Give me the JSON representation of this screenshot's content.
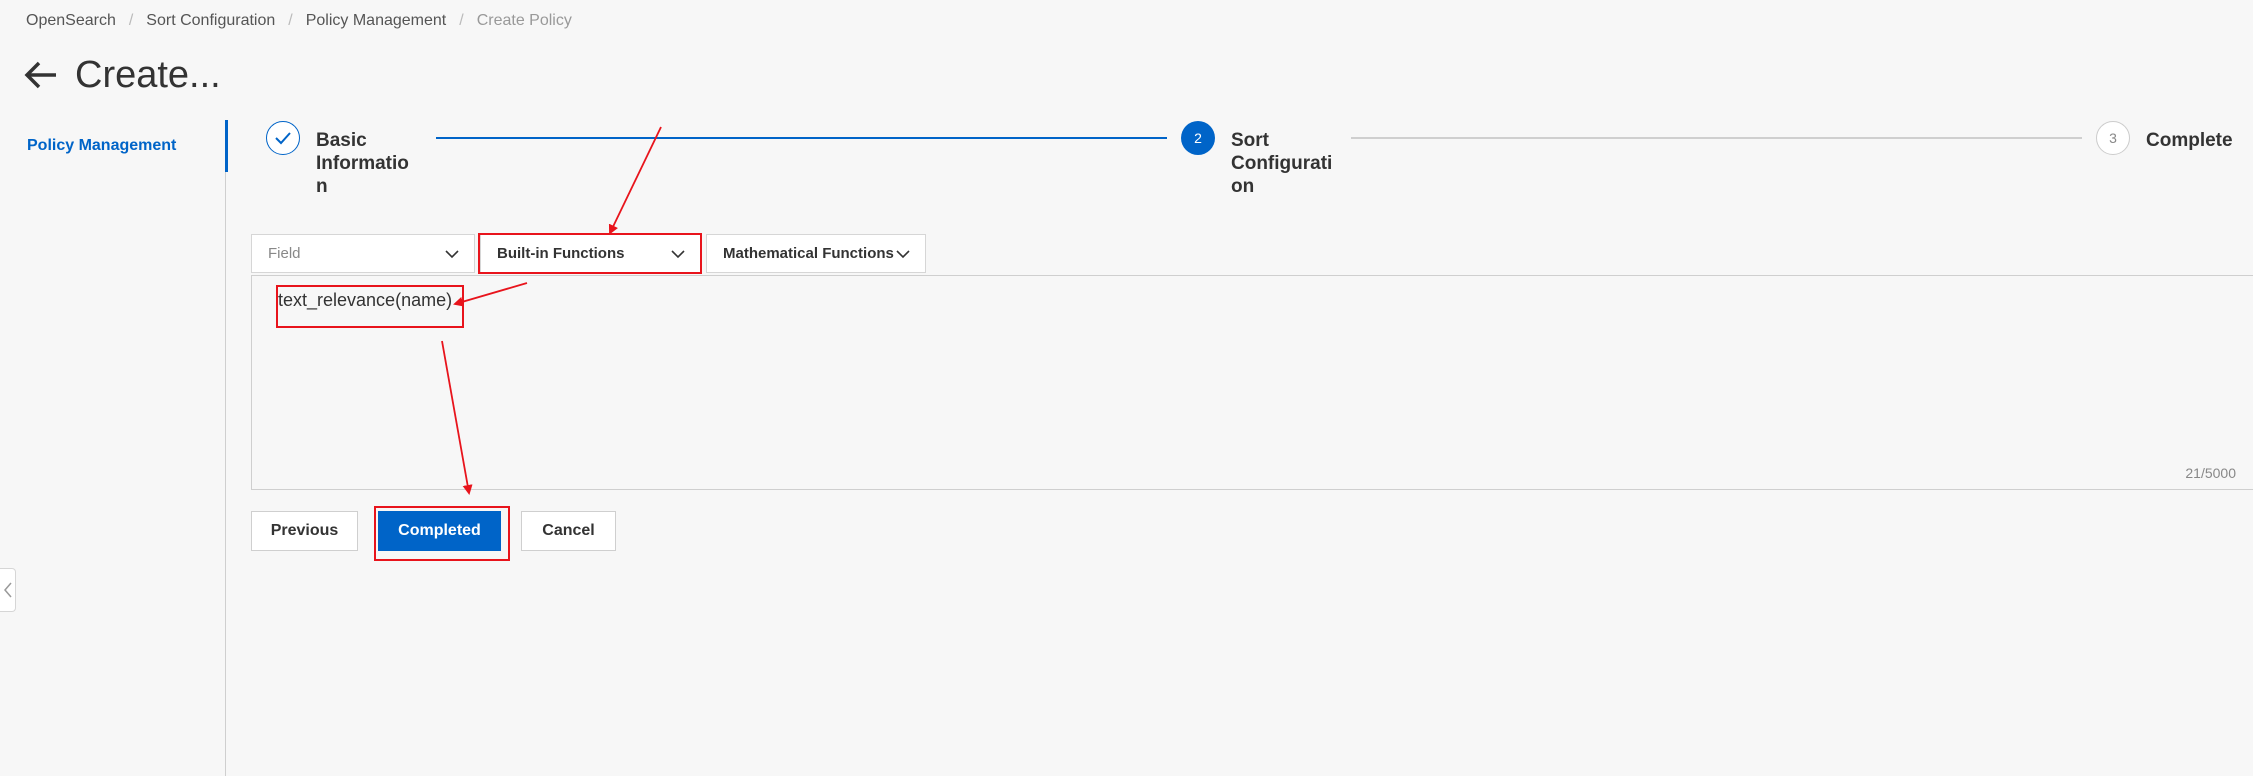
{
  "breadcrumb": {
    "items": [
      "OpenSearch",
      "Sort Configuration",
      "Policy Management",
      "Create Policy"
    ],
    "separator": "/"
  },
  "header": {
    "title": "Create..."
  },
  "sidebar": {
    "items": [
      {
        "label": "Policy Management",
        "active": true
      }
    ]
  },
  "steps": [
    {
      "number": "1",
      "label": "Basic Informatio n",
      "status": "done"
    },
    {
      "number": "2",
      "label": "Sort Configurati on",
      "status": "active"
    },
    {
      "number": "3",
      "label": "Complete",
      "status": "pending"
    }
  ],
  "toolbar": {
    "field_placeholder": "Field",
    "builtin_label": "Built-in Functions",
    "math_label": "Mathematical Functions"
  },
  "editor": {
    "value": "text_relevance(name)",
    "char_count": "21/5000"
  },
  "buttons": {
    "previous": "Previous",
    "completed": "Completed",
    "cancel": "Cancel"
  },
  "colors": {
    "accent": "#0064c8",
    "annotation": "#e8141c",
    "background": "#f7f7f7"
  }
}
